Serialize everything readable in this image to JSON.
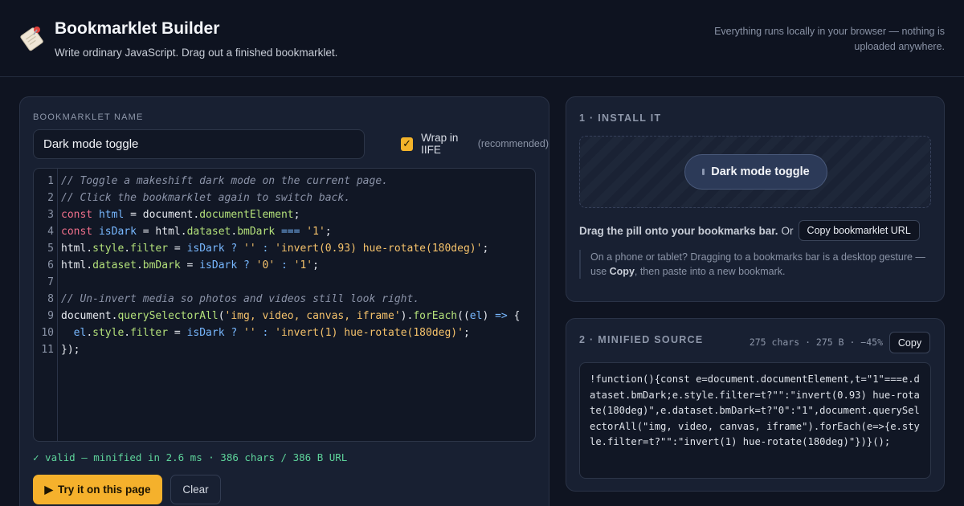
{
  "header": {
    "title": "Bookmarklet Builder",
    "subtitle": "Write ordinary JavaScript. Drag out a finished bookmarklet.",
    "note": "Everything runs locally in your browser — nothing is uploaded anywhere.",
    "logo_icon": "bookmark-pin-icon"
  },
  "editor_panel": {
    "name_label": "BOOKMARKLET NAME",
    "name_value": "Dark mode toggle",
    "iife_label": "Wrap in IIFE",
    "iife_hint": "(recommended)",
    "iife_checked": true,
    "line_numbers": [
      "1",
      "2",
      "3",
      "4",
      "5",
      "6",
      "7",
      "8",
      "9",
      "10",
      "11"
    ],
    "code_lines": [
      "// Toggle a makeshift dark mode on the current page.",
      "// Click the bookmarklet again to switch back.",
      "const html = document.documentElement;",
      "const isDark = html.dataset.bmDark === '1';",
      "html.style.filter = isDark ? '' : 'invert(0.93) hue-rotate(180deg)';",
      "html.dataset.bmDark = isDark ? '0' : '1';",
      "",
      "// Un-invert media so photos and videos still look right.",
      "document.querySelectorAll('img, video, canvas, iframe').forEach((el) => {",
      "  el.style.filter = isDark ? '' : 'invert(1) hue-rotate(180deg)';",
      "});"
    ],
    "status": "✓ valid — minified in 2.6 ms · 386 chars / 386 B URL",
    "try_label": "Try it on this page",
    "clear_label": "Clear"
  },
  "install_panel": {
    "title": "1 · INSTALL IT",
    "pill_label": "Dark mode toggle",
    "drag_text": "Drag the pill onto your bookmarks bar.",
    "or_text": "Or",
    "copy_url_label": "Copy bookmarklet URL",
    "mobile_note_pre": "On a phone or tablet? Dragging to a bookmarks bar is a desktop gesture — use ",
    "mobile_note_bold": "Copy",
    "mobile_note_post": ", then paste into a new bookmark."
  },
  "minified_panel": {
    "title": "2 · MINIFIED SOURCE",
    "stats": "275 chars · 275 B · −45%",
    "copy_label": "Copy",
    "source": "!function(){const e=document.documentElement,t=\"1\"===e.dataset.bmDark;e.style.filter=t?\"\":\"invert(0.93) hue-rotate(180deg)\",e.dataset.bmDark=t?\"0\":\"1\",document.querySelectorAll(\"img, video, canvas, iframe\").forEach(e=>{e.style.filter=t?\"\":\"invert(1) hue-rotate(180deg)\"})}();"
  },
  "colors": {
    "background": "#0f1421",
    "panel": "#182032",
    "accent": "#f5b12c",
    "success": "#5ed49b"
  }
}
